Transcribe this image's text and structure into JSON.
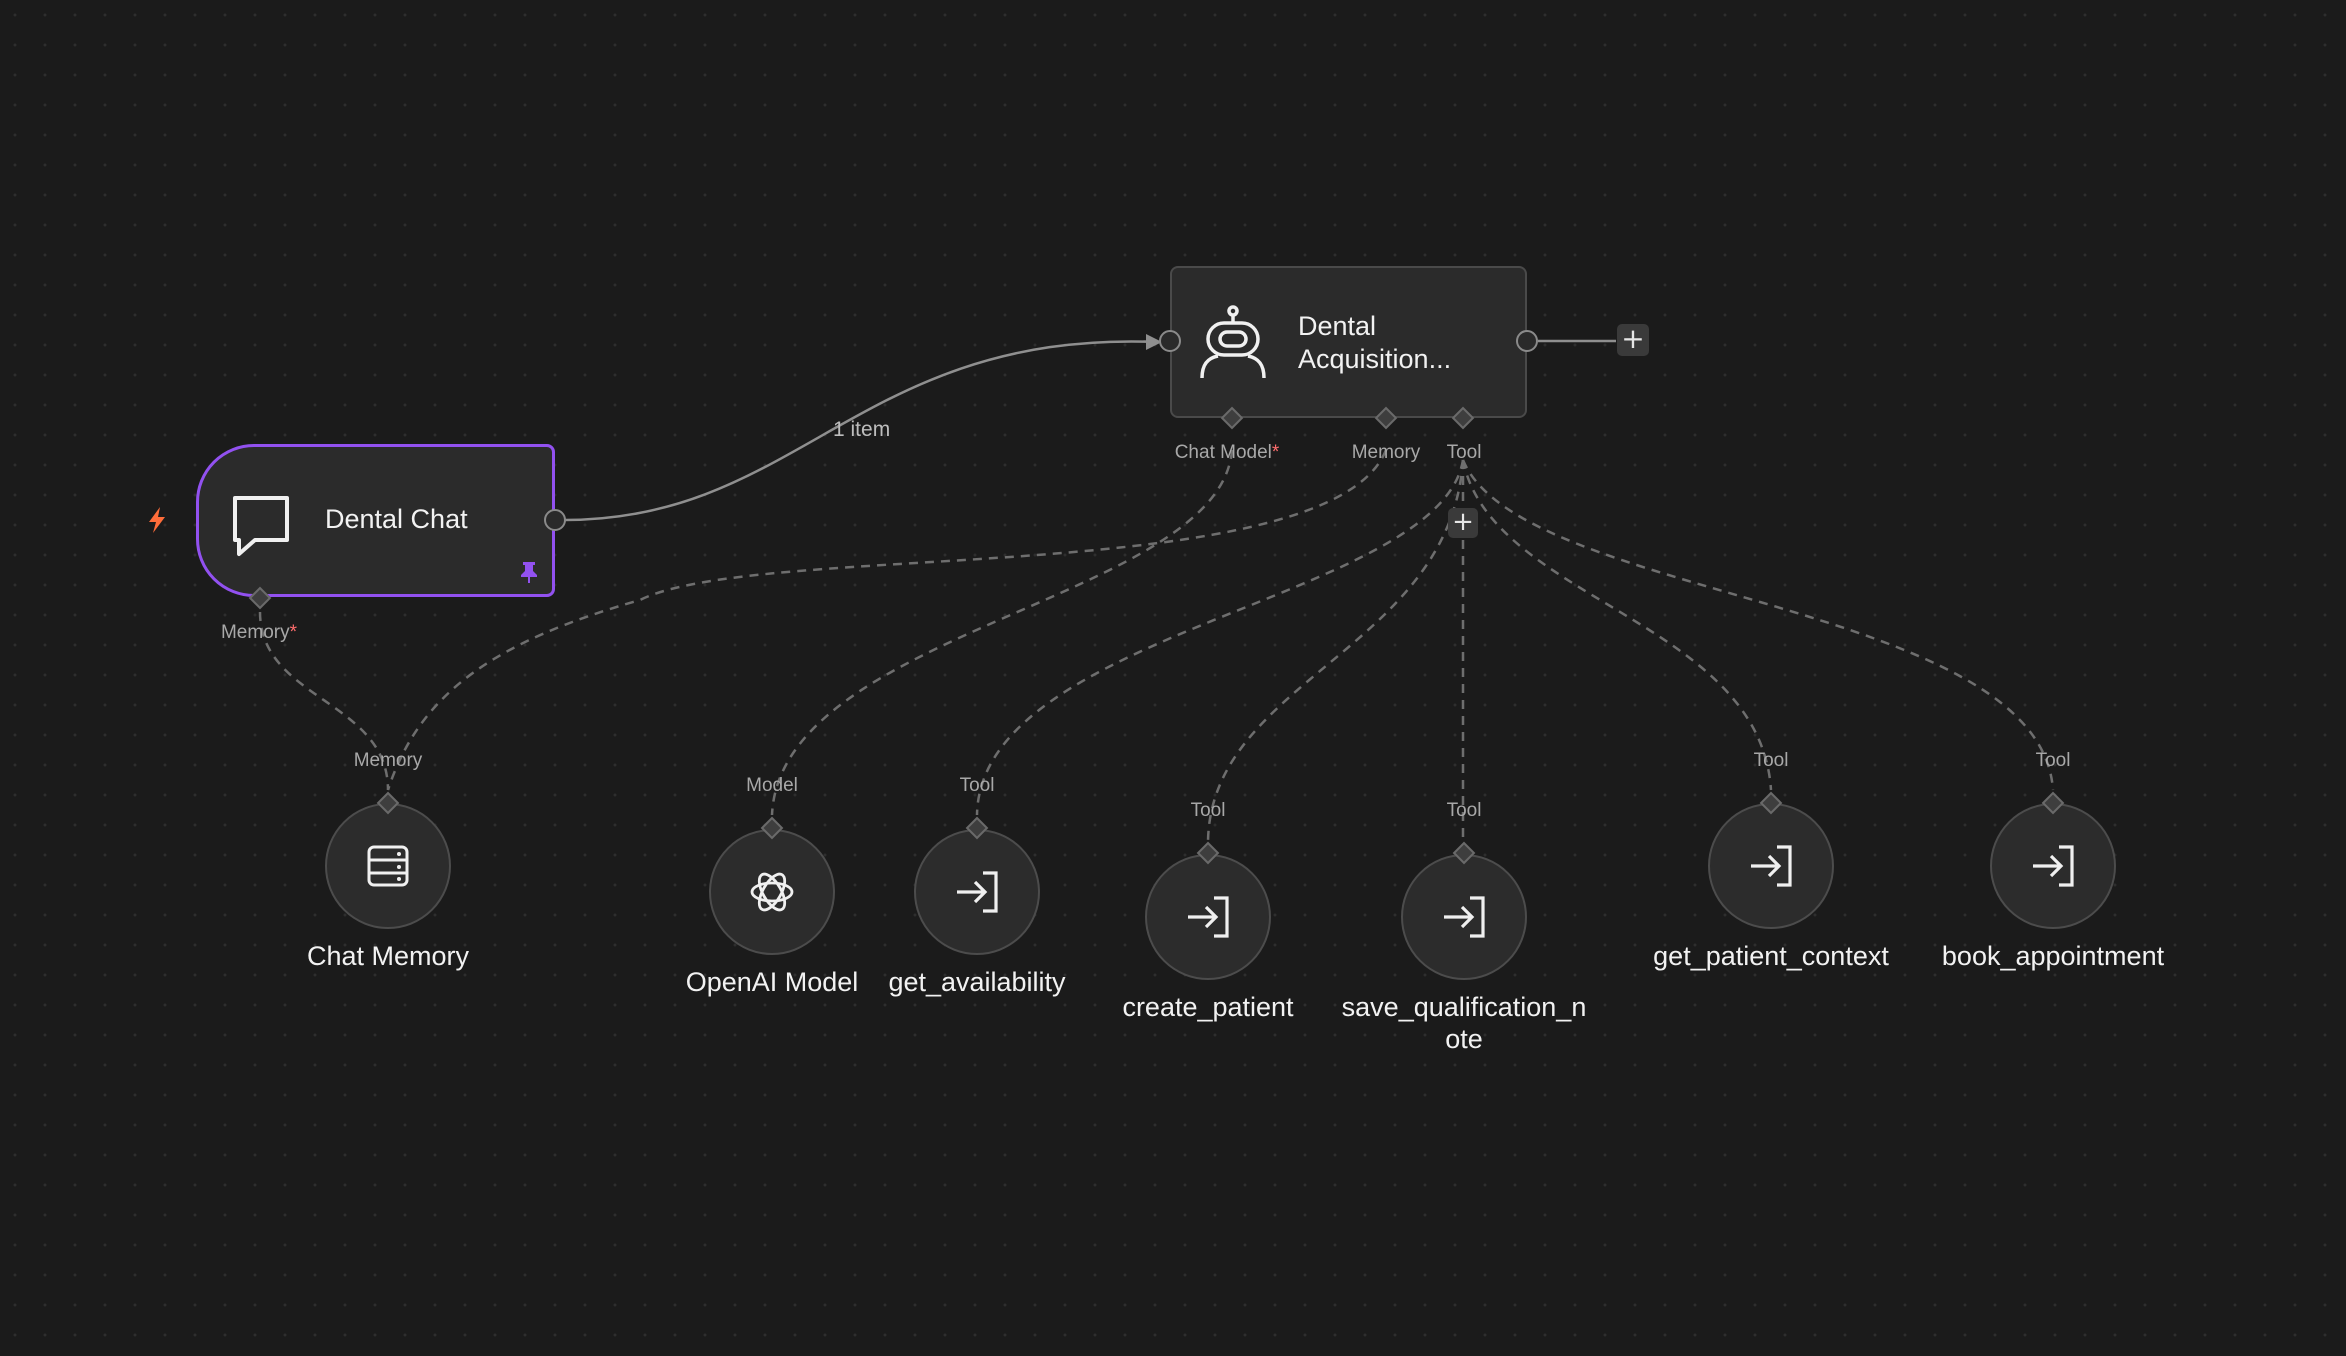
{
  "colors": {
    "background": "#1b1b1b",
    "node_fill": "#2b2b2b",
    "trigger_border": "#9251f0",
    "required_marker": "#ff6d6d",
    "trigger_bolt": "#ff6d3a"
  },
  "edge": {
    "label": "1 item"
  },
  "agent_node": {
    "title": "Dental Acquisition...",
    "icon": "robot-icon",
    "ports": {
      "chat_model_label": "Chat Model",
      "memory_label": "Memory",
      "tool_label": "Tool",
      "required_marker": "*"
    }
  },
  "trigger_node": {
    "title": "Dental Chat",
    "icon": "chat-bubble-icon",
    "trigger_icon": "lightning-bolt-icon",
    "pinned_icon": "pin-icon",
    "ports": {
      "memory_label": "Memory",
      "required_marker": "*"
    }
  },
  "sub_nodes": [
    {
      "name": "Chat Memory",
      "port_label": "Memory",
      "icon": "database-icon"
    },
    {
      "name": "OpenAI Model",
      "port_label": "Model",
      "icon": "openai-icon"
    },
    {
      "name": "get_availability",
      "port_label": "Tool",
      "icon": "tool-arrow-icon"
    },
    {
      "name": "create_patient",
      "port_label": "Tool",
      "icon": "tool-arrow-icon"
    },
    {
      "name": "save_qualification_n\note",
      "port_label": "Tool",
      "icon": "tool-arrow-icon"
    },
    {
      "name": "get_patient_context",
      "port_label": "Tool",
      "icon": "tool-arrow-icon"
    },
    {
      "name": "book_appointment",
      "port_label": "Tool",
      "icon": "tool-arrow-icon"
    }
  ],
  "buttons": {
    "add_next_node": "+",
    "add_tool": "+"
  }
}
